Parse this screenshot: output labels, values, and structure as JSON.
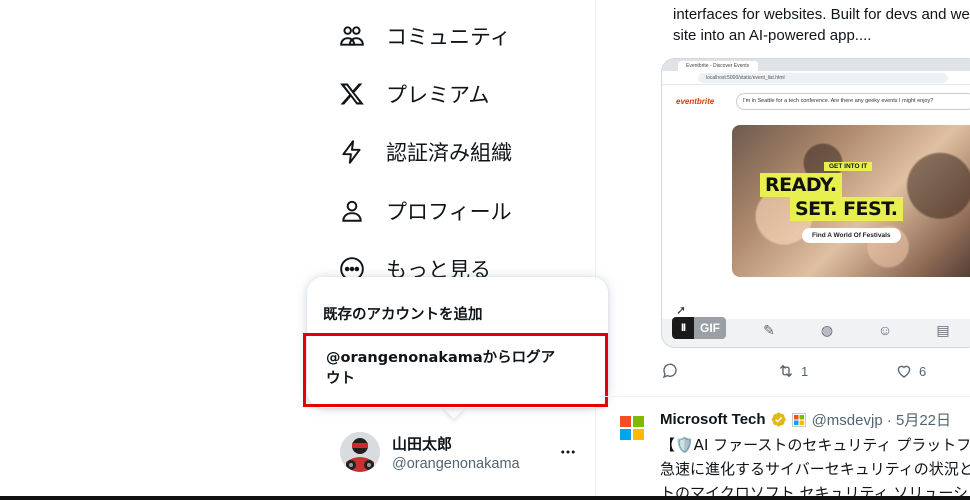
{
  "nav": {
    "items": [
      {
        "label": "コミュニティ",
        "icon": "communities-icon"
      },
      {
        "label": "プレミアム",
        "icon": "x-logo-icon"
      },
      {
        "label": "認証済み組織",
        "icon": "lightning-icon"
      },
      {
        "label": "プロフィール",
        "icon": "profile-icon"
      },
      {
        "label": "もっと見る",
        "icon": "more-circle-icon"
      }
    ]
  },
  "popover": {
    "add_account": "既存のアカウントを追加",
    "logout": "@orangenonakamaからログアウト"
  },
  "account": {
    "name": "山田太郎",
    "handle": "@orangenonakama",
    "more_icon": "ellipsis-icon"
  },
  "timeline": {
    "tweet1": {
      "text_line1": "interfaces for websites. Built for devs and web",
      "text_line2": "site into an AI-powered app....",
      "media": {
        "browser_tab": "Eventbrite - Discover Events",
        "address": "localhost:5000/static/event_list.html",
        "site_logo": "eventbrite",
        "search_text": "I'm in Seattle for a tech conference.  Are there any geeky events I might enjoy?",
        "banner_small": "GET INTO IT",
        "banner_line1": "READY.",
        "banner_line2": "SET. FEST.",
        "banner_cta": "Find A World Of Festivals",
        "gif_label": "GIF",
        "pause_symbol": "II"
      },
      "reply_count": "",
      "retweet_count": "1",
      "like_count": "6"
    },
    "tweet2": {
      "name": "Microsoft Tech",
      "handle_date": "@msdevjp · 5月22日",
      "line1": "【🛡️AI ファーストのセキュリティ プラットフ",
      "line2": "急速に進化するサイバーセキュリティの状況と",
      "line3": "トのマイクロソフト セキュリティ ソリューシ"
    }
  },
  "colors": {
    "highlight_border": "#e60000",
    "verified_gold": "#e2b719",
    "muted_text": "#536471"
  }
}
